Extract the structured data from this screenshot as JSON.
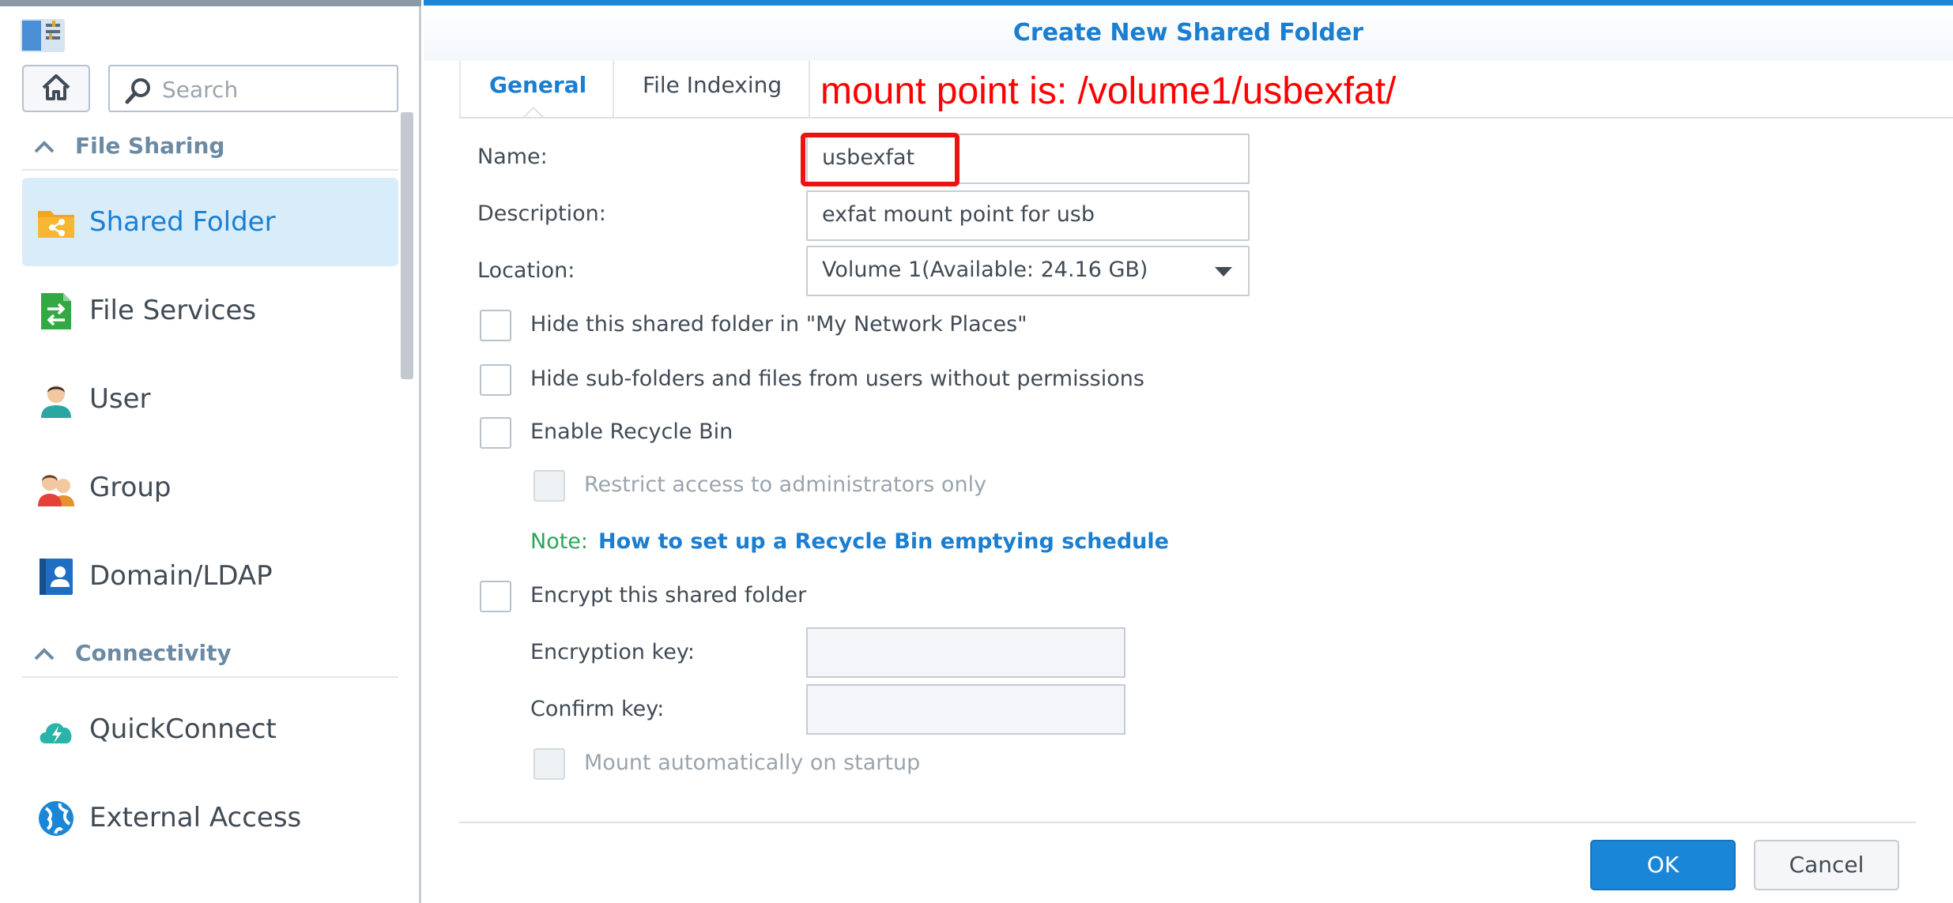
{
  "sidebar": {
    "search": {
      "placeholder": "Search"
    },
    "sections": [
      {
        "label": "File Sharing"
      },
      {
        "label": "Connectivity"
      }
    ],
    "items": [
      {
        "label": "Shared Folder",
        "icon": "shared-folder-icon",
        "active": true
      },
      {
        "label": "File Services",
        "icon": "file-services-icon"
      },
      {
        "label": "User",
        "icon": "user-icon"
      },
      {
        "label": "Group",
        "icon": "group-icon"
      },
      {
        "label": "Domain/LDAP",
        "icon": "domain-ldap-icon"
      },
      {
        "label": "QuickConnect",
        "icon": "quickconnect-icon"
      },
      {
        "label": "External Access",
        "icon": "external-access-icon"
      }
    ]
  },
  "dialog": {
    "title": "Create New Shared Folder",
    "tabs": [
      {
        "label": "General",
        "active": true
      },
      {
        "label": "File Indexing"
      }
    ],
    "annotation": "mount point is: /volume1/usbexfat/",
    "fields": {
      "name": {
        "label": "Name:",
        "value": "usbexfat"
      },
      "description": {
        "label": "Description:",
        "value": "exfat mount point for usb"
      },
      "location": {
        "label": "Location:",
        "value": "Volume 1(Available: 24.16 GB)"
      }
    },
    "checkboxes": {
      "hide_network": "Hide this shared folder in \"My Network Places\"",
      "hide_subfolders": "Hide sub-folders and files from users without permissions",
      "recycle_bin": "Enable Recycle Bin",
      "restrict_admin": "Restrict access to administrators only",
      "encrypt": "Encrypt this shared folder",
      "mount_auto": "Mount automatically on startup"
    },
    "note": {
      "prefix": "Note:",
      "link": "How to set up a Recycle Bin emptying schedule"
    },
    "encryption": {
      "key_label": "Encryption key:",
      "confirm_label": "Confirm key:"
    },
    "buttons": {
      "ok": "OK",
      "cancel": "Cancel"
    }
  },
  "colors": {
    "accent": "#1a7ed1",
    "annotation": "#ff0000",
    "note": "#2ca55c",
    "active_item_bg": "#d9ecfa"
  }
}
